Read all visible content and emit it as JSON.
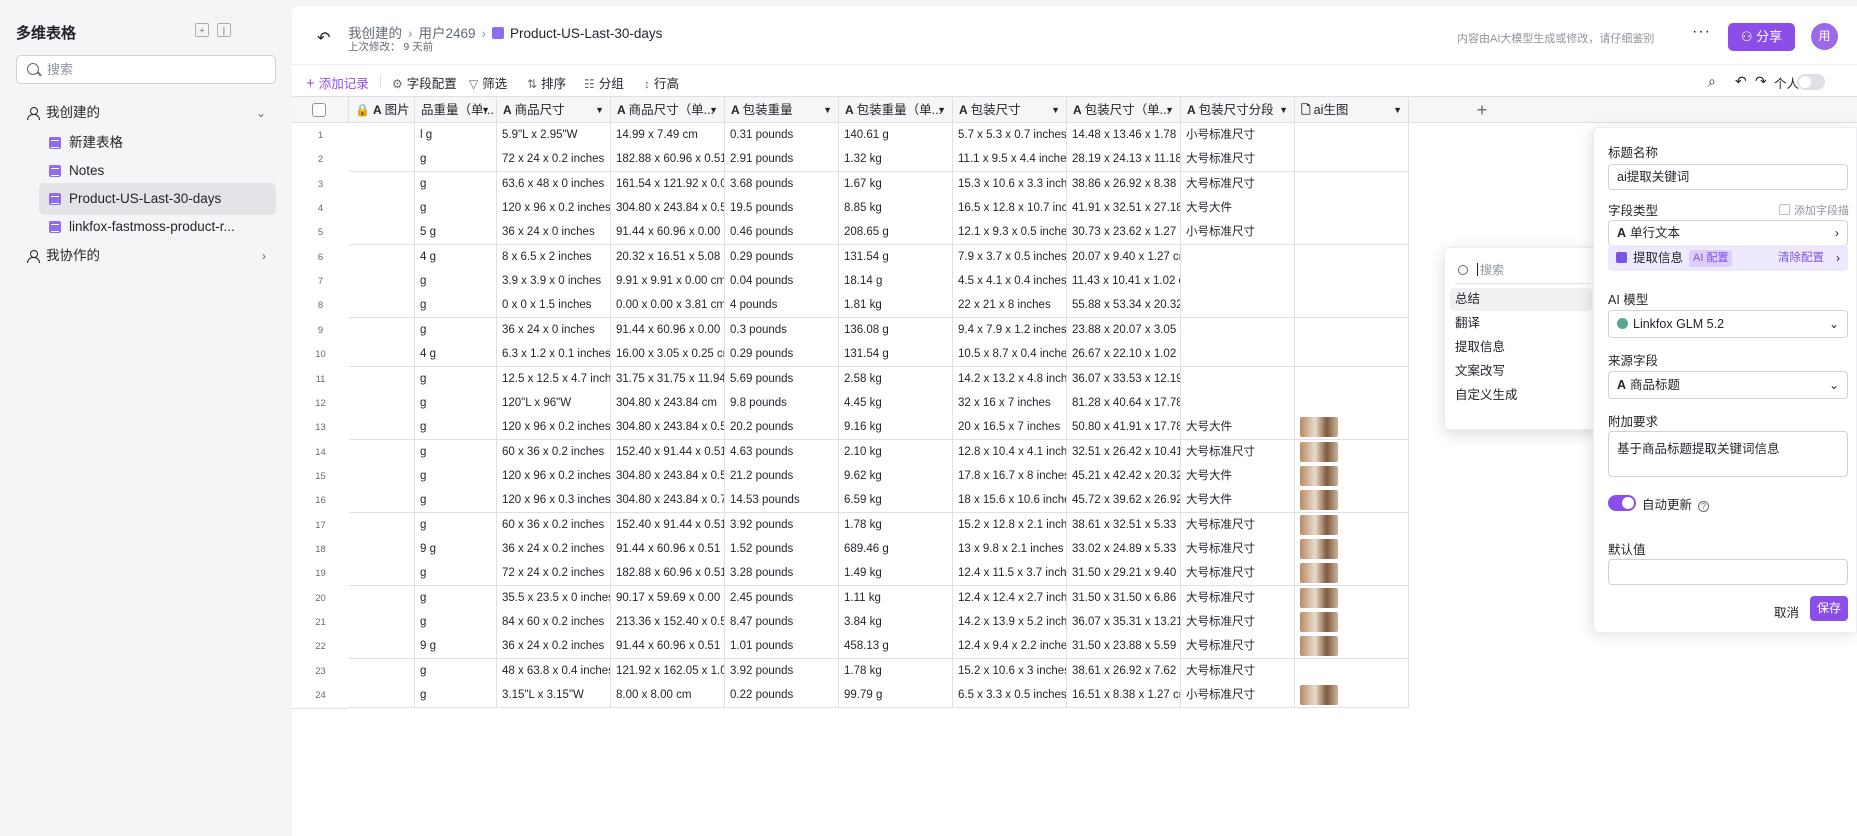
{
  "sidebar": {
    "title": "多维表格",
    "search_placeholder": "搜索",
    "group_mine": "我创建的",
    "items": [
      "新建表格",
      "Notes",
      "Product-US-Last-30-days",
      "linkfox-fastmoss-product-r..."
    ],
    "group_shared": "我协作的"
  },
  "header": {
    "crumb1": "我创建的",
    "crumb2": "用户2469",
    "crumb3": "Product-US-Last-30-days",
    "subtitle": "上次修改： 9 天前",
    "ai_note": "内容由AI大模型生成或修改，请仔细鉴别",
    "share_label": "分享",
    "avatar_text": "用"
  },
  "toolbar": {
    "add": "添加记录",
    "fields": "字段配置",
    "filter": "筛选",
    "sort": "排序",
    "group": "分组",
    "row_height": "行高",
    "personal": "个人"
  },
  "columns": [
    "图片",
    "品重量（单...",
    "商品尺寸",
    "商品尺寸（单...",
    "包装重量",
    "包装重量（单...",
    "包装尺寸",
    "包装尺寸（单...",
    "包装尺寸分段",
    "ai生图"
  ],
  "rows": [
    [
      "1",
      "l g",
      "5.9\"L x 2.95\"W",
      "14.99 x 7.49 cm",
      "0.31 pounds",
      "140.61 g",
      "5.7 x 5.3 x 0.7 inches",
      "14.48 x 13.46 x 1.78 cm",
      "小号标准尺寸"
    ],
    [
      "2",
      "g",
      "72 x 24 x 0.2 inches",
      "182.88 x 60.96 x 0.51 ...",
      "2.91 pounds",
      "1.32 kg",
      "11.1 x 9.5 x 4.4 inches",
      "28.19 x 24.13 x 11.18 ...",
      "大号标准尺寸"
    ],
    [
      "3",
      "g",
      "63.6 x 48 x 0 inches",
      "161.54 x 121.92 x 0.00...",
      "3.68 pounds",
      "1.67 kg",
      "15.3 x 10.6 x 3.3 inches",
      "38.86 x 26.92 x 8.38 cm",
      "大号标准尺寸"
    ],
    [
      "4",
      "g",
      "120 x 96 x 0.2 inches",
      "304.80 x 243.84 x 0.51...",
      "19.5 pounds",
      "8.85 kg",
      "16.5 x 12.8 x 10.7 inch...",
      "41.91 x 32.51 x 27.18 ...",
      "大号大件"
    ],
    [
      "5",
      "5 g",
      "36 x 24 x 0 inches",
      "91.44 x 60.96 x 0.00 cm",
      "0.46 pounds",
      "208.65 g",
      "12.1 x 9.3 x 0.5 inches",
      "30.73 x 23.62 x 1.27 cm",
      "小号标准尺寸"
    ],
    [
      "6",
      "4 g",
      "8 x 6.5 x 2 inches",
      "20.32 x 16.51 x 5.08 cm",
      "0.29 pounds",
      "131.54 g",
      "7.9 x 3.7 x 0.5 inches",
      "20.07 x 9.40 x 1.27 cm",
      ""
    ],
    [
      "7",
      "g",
      "3.9 x 3.9 x 0 inches",
      "9.91 x 9.91 x 0.00 cm",
      "0.04 pounds",
      "18.14 g",
      "4.5 x 4.1 x 0.4 inches",
      "11.43 x 10.41 x 1.02 cm",
      ""
    ],
    [
      "8",
      "g",
      "0 x 0 x 1.5 inches",
      "0.00 x 0.00 x 3.81 cm",
      "4 pounds",
      "1.81 kg",
      "22 x 21 x 8 inches",
      "55.88 x 53.34 x 20.32 ...",
      ""
    ],
    [
      "9",
      "g",
      "36 x 24 x 0 inches",
      "91.44 x 60.96 x 0.00 cm",
      "0.3 pounds",
      "136.08 g",
      "9.4 x 7.9 x 1.2 inches",
      "23.88 x 20.07 x 3.05 cm",
      ""
    ],
    [
      "10",
      "4 g",
      "6.3 x 1.2 x 0.1 inches",
      "16.00 x 3.05 x 0.25 cm",
      "0.29 pounds",
      "131.54 g",
      "10.5 x 8.7 x 0.4 inches",
      "26.67 x 22.10 x 1.02 cm",
      ""
    ],
    [
      "11",
      "g",
      "12.5 x 12.5 x 4.7 inches",
      "31.75 x 31.75 x 11.94 ...",
      "5.69 pounds",
      "2.58 kg",
      "14.2 x 13.2 x 4.8 inches",
      "36.07 x 33.53 x 12.19 ...",
      ""
    ],
    [
      "12",
      "g",
      "120\"L x 96\"W",
      "304.80 x 243.84 cm",
      "9.8 pounds",
      "4.45 kg",
      "32 x 16 x 7 inches",
      "81.28 x 40.64 x 17.78 ...",
      ""
    ],
    [
      "13",
      "g",
      "120 x 96 x 0.2 inches",
      "304.80 x 243.84 x 0.51...",
      "20.2 pounds",
      "9.16 kg",
      "20 x 16.5 x 7 inches",
      "50.80 x 41.91 x 17.78 ...",
      "大号大件"
    ],
    [
      "14",
      "g",
      "60 x 36 x 0.2 inches",
      "152.40 x 91.44 x 0.51 ...",
      "4.63 pounds",
      "2.10 kg",
      "12.8 x 10.4 x 4.1 inches",
      "32.51 x 26.42 x 10.41 ...",
      "大号标准尺寸"
    ],
    [
      "15",
      "g",
      "120 x 96 x 0.2 inches",
      "304.80 x 243.84 x 0.51...",
      "21.2 pounds",
      "9.62 kg",
      "17.8 x 16.7 x 8 inches",
      "45.21 x 42.42 x 20.32 ...",
      "大号大件"
    ],
    [
      "16",
      "g",
      "120 x 96 x 0.3 inches",
      "304.80 x 243.84 x 0.76...",
      "14.53 pounds",
      "6.59 kg",
      "18 x 15.6 x 10.6 inches",
      "45.72 x 39.62 x 26.92 ...",
      "大号大件"
    ],
    [
      "17",
      "g",
      "60 x 36 x 0.2 inches",
      "152.40 x 91.44 x 0.51 ...",
      "3.92 pounds",
      "1.78 kg",
      "15.2 x 12.8 x 2.1 inches",
      "38.61 x 32.51 x 5.33 cm",
      "大号标准尺寸"
    ],
    [
      "18",
      "9 g",
      "36 x 24 x 0.2 inches",
      "91.44 x 60.96 x 0.51 cm",
      "1.52 pounds",
      "689.46 g",
      "13 x 9.8 x 2.1 inches",
      "33.02 x 24.89 x 5.33 cm",
      "大号标准尺寸"
    ],
    [
      "19",
      "g",
      "72 x 24 x 0.2 inches",
      "182.88 x 60.96 x 0.51 ...",
      "3.28 pounds",
      "1.49 kg",
      "12.4 x 11.5 x 3.7 inches",
      "31.50 x 29.21 x 9.40 cm",
      "大号标准尺寸"
    ],
    [
      "20",
      "g",
      "35.5 x 23.5 x 0 inches",
      "90.17 x 59.69 x 0.00 cm",
      "2.45 pounds",
      "1.11 kg",
      "12.4 x 12.4 x 2.7 inches",
      "31.50 x 31.50 x 6.86 cm",
      "大号标准尺寸"
    ],
    [
      "21",
      "g",
      "84 x 60 x 0.2 inches",
      "213.36 x 152.40 x 0.51...",
      "8.47 pounds",
      "3.84 kg",
      "14.2 x 13.9 x 5.2 inches",
      "36.07 x 35.31 x 13.21 ...",
      "大号标准尺寸"
    ],
    [
      "22",
      "9 g",
      "36 x 24 x 0.2 inches",
      "91.44 x 60.96 x 0.51 cm",
      "1.01 pounds",
      "458.13 g",
      "12.4 x 9.4 x 2.2 inches",
      "31.50 x 23.88 x 5.59 cm",
      "大号标准尺寸"
    ],
    [
      "23",
      "g",
      "48 x 63.8 x 0.4 inches",
      "121.92 x 162.05 x 1.02...",
      "3.92 pounds",
      "1.78 kg",
      "15.2 x 10.6 x 3 inches",
      "38.61 x 26.92 x 7.62 cm",
      "大号标准尺寸"
    ],
    [
      "24",
      "g",
      "3.15\"L x 3.15\"W",
      "8.00 x 8.00 cm",
      "0.22 pounds",
      "99.79 g",
      "6.5 x 3.3 x 0.5 inches",
      "16.51 x 8.38 x 1.27 cm",
      "小号标准尺寸"
    ]
  ],
  "dropdown": {
    "search_placeholder": "搜索",
    "items": [
      "总结",
      "翻译",
      "提取信息",
      "文案改写",
      "自定义生成"
    ]
  },
  "panel": {
    "title_label": "标题名称",
    "title_value": "ai提取关键词",
    "field_type_label": "字段类型",
    "add_desc": "添加字段描述",
    "field_type_value": "单行文本",
    "extract_label": "提取信息",
    "ai_tag": "AI 配置",
    "clear_config": "清除配置",
    "model_label": "AI 模型",
    "model_value": "Linkfox GLM 5.2",
    "source_label": "来源字段",
    "source_value": "商品标题",
    "extra_label": "附加要求",
    "extra_value": "基于商品标题提取关键词信息",
    "auto_update": "自动更新",
    "default_label": "默认值",
    "cancel": "取消",
    "save": "保存"
  }
}
